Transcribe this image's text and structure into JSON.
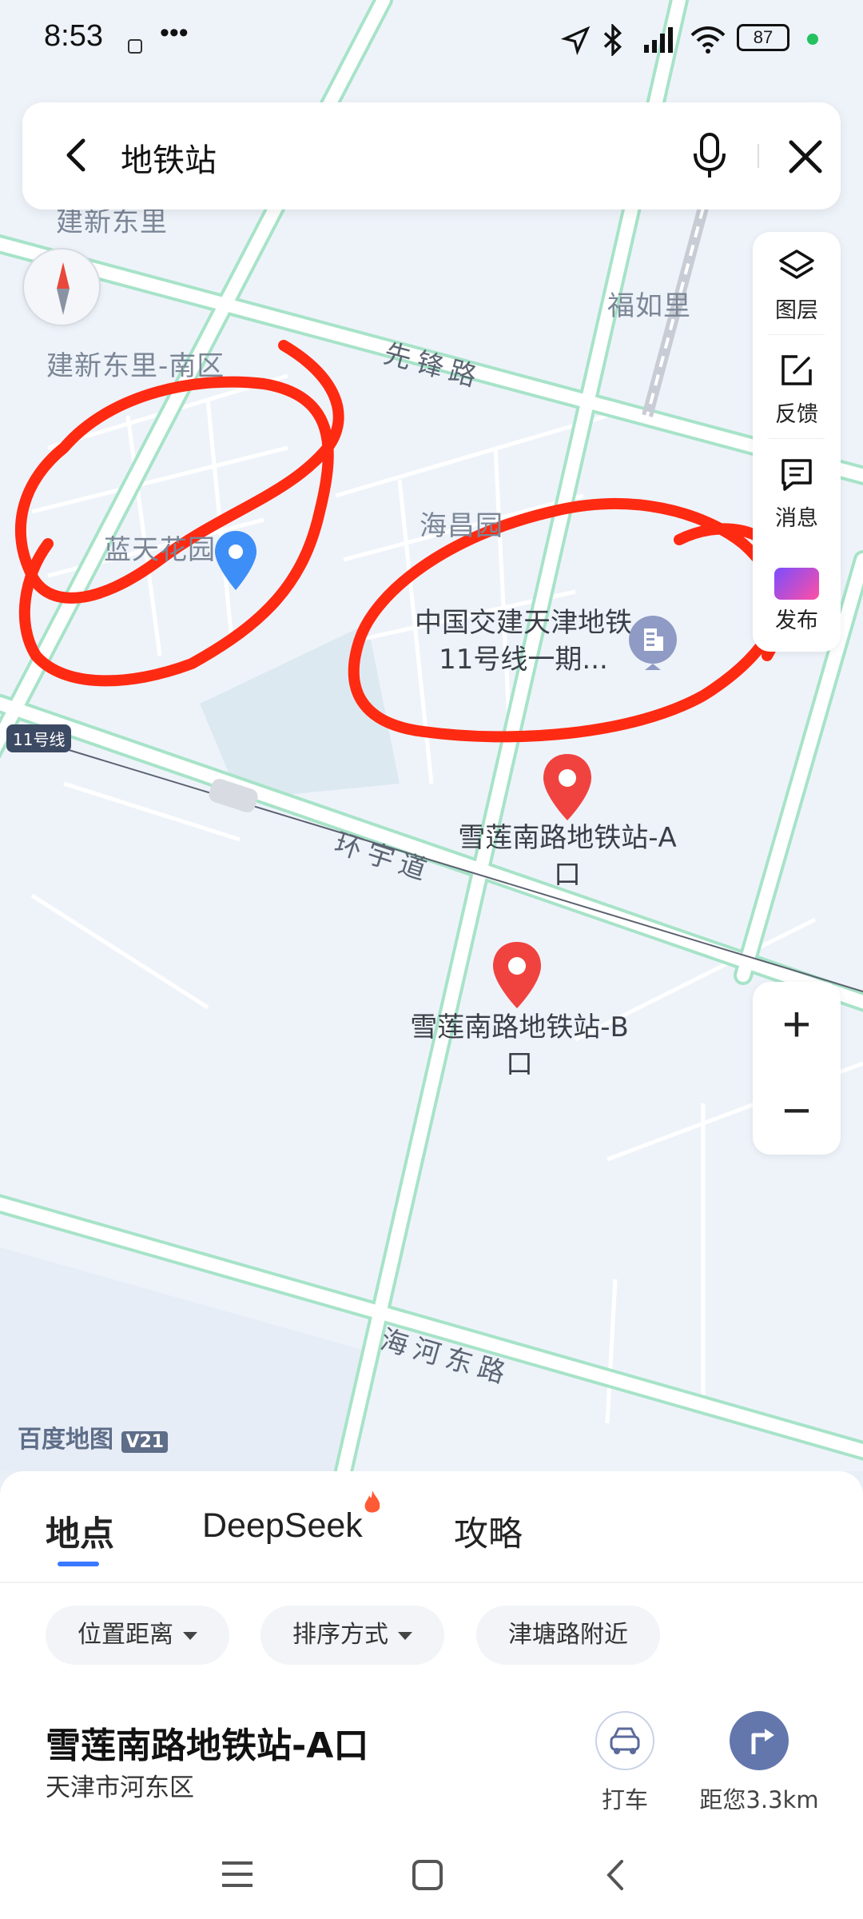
{
  "status_bar": {
    "time": "8:53",
    "battery": "87"
  },
  "search": {
    "query": "地铁站"
  },
  "map": {
    "area_labels": [
      "建新东里",
      "建新东里-南区",
      "福如里",
      "海昌园",
      "蓝天花园"
    ],
    "road_labels": [
      "先锋路",
      "环宇道",
      "海河东路"
    ],
    "line_badge": "11号线",
    "poi_building": "中国交建天津地铁11号线一期...",
    "pin_a": "雪莲南路地铁站-A口",
    "pin_b": "雪莲南路地铁站-B口",
    "watermark": "百度地图",
    "watermark_version": "V21"
  },
  "tools": {
    "layers": "图层",
    "feedback": "反馈",
    "messages": "消息",
    "publish": "发布"
  },
  "tabs": [
    "地点",
    "DeepSeek",
    "攻略"
  ],
  "filters": [
    "位置距离",
    "排序方式",
    "津塘路附近"
  ],
  "result": {
    "title": "雪莲南路地铁站-A口",
    "district": "天津市河东区",
    "taxi_label": "打车",
    "distance_label": "距您3.3km"
  },
  "colors": {
    "accent": "#3a78ff",
    "pin_red": "#f0433f",
    "road_green": "#9fe0c4",
    "annotation_red": "#ff2a12"
  }
}
